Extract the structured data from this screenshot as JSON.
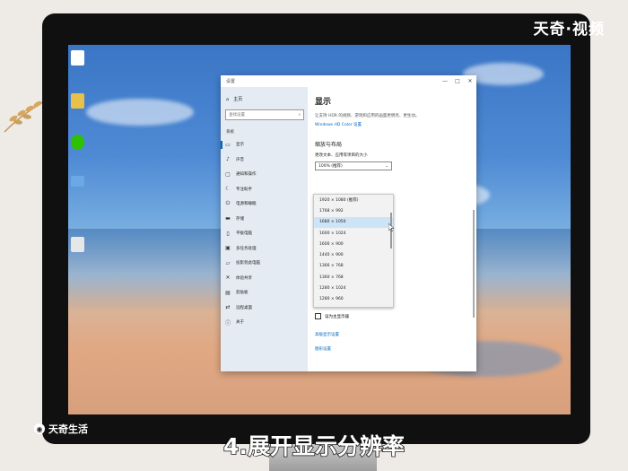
{
  "watermark_top": "天奇·视频",
  "watermark_bottom": "天奇生活",
  "subtitle": "4.展开显示分辨率",
  "window": {
    "title": "设置",
    "controls": [
      "—",
      "□",
      "✕"
    ]
  },
  "nav": {
    "home_label": "主页",
    "search_placeholder": "查找设置",
    "section_label": "系统",
    "items": [
      {
        "icon": "monitor-icon",
        "glyph": "▭",
        "label": "显示"
      },
      {
        "icon": "sound-icon",
        "glyph": "♪",
        "label": "声音"
      },
      {
        "icon": "notifications-icon",
        "glyph": "▢",
        "label": "通知和操作"
      },
      {
        "icon": "focus-assist-icon",
        "glyph": "☾",
        "label": "专注助手"
      },
      {
        "icon": "power-icon",
        "glyph": "⏻",
        "label": "电源和睡眠"
      },
      {
        "icon": "storage-icon",
        "glyph": "▬",
        "label": "存储"
      },
      {
        "icon": "tablet-icon",
        "glyph": "▯",
        "label": "平板电脑"
      },
      {
        "icon": "multitasking-icon",
        "glyph": "▣",
        "label": "多任务处理"
      },
      {
        "icon": "project-icon",
        "glyph": "▱",
        "label": "投影到此电脑"
      },
      {
        "icon": "shared-experiences-icon",
        "glyph": "✕",
        "label": "体验共享"
      },
      {
        "icon": "clipboard-icon",
        "glyph": "▤",
        "label": "剪贴板"
      },
      {
        "icon": "remote-desktop-icon",
        "glyph": "⇄",
        "label": "远程桌面"
      },
      {
        "icon": "about-icon",
        "glyph": "ⓘ",
        "label": "关于"
      }
    ]
  },
  "content": {
    "heading": "显示",
    "hdr_desc": "让支持 HDR 的视频、游戏和应用的画面更明亮、更生动。",
    "hdr_link": "Windows HD Color 设置",
    "scale_heading": "缩放与布局",
    "scale_label": "更改文本、应用等项目的大小",
    "scale_value": "100% (推荐)",
    "resolutions": [
      "1920 × 1080 (推荐)",
      "1768 × 992",
      "1680 × 1050",
      "1600 × 1024",
      "1600 × 900",
      "1440 × 900",
      "1366 × 768",
      "1360 × 768",
      "1280 × 1024",
      "1280 × 960"
    ],
    "selected_resolution_index": 2,
    "checkbox_label": "设为主显示器",
    "advanced_link": "高级显示设置",
    "graphics_link": "图形设置"
  }
}
